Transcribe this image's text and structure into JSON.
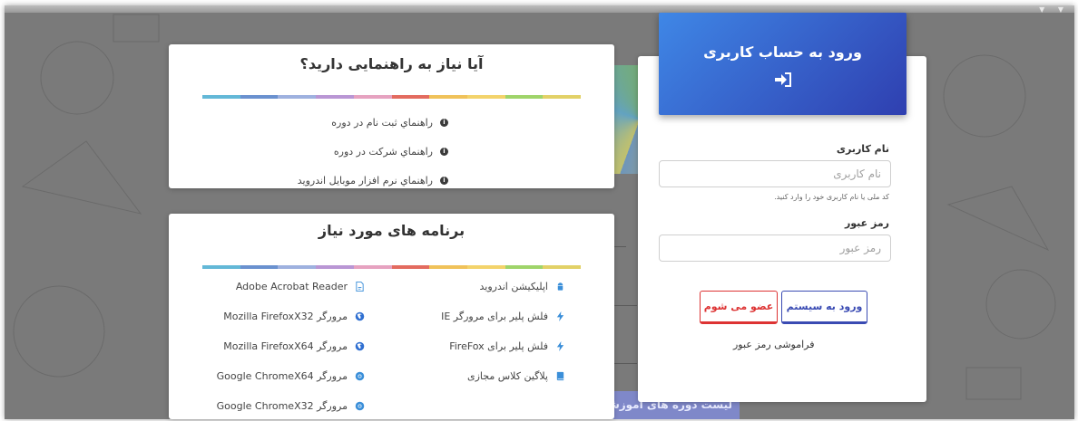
{
  "colors": {
    "rainbow": [
      "#e2d167",
      "#9fd46a",
      "#f3d36b",
      "#f0c25a",
      "#e36b5f",
      "#e6a2c0",
      "#b996d4",
      "#9eb1df",
      "#6a91cf",
      "#63b8d7"
    ],
    "login_header_start": "#3f87e6",
    "login_header_end": "#2f3fb0",
    "primary": "#3a4bb3",
    "danger": "#dd3333"
  },
  "help": {
    "title": "آیا نیاز به راهنمایی دارید؟",
    "links": [
      {
        "label": "راهنماي ثبت نام در دوره",
        "icon": "info-circle-icon"
      },
      {
        "label": "راهنماي شرکت در دوره",
        "icon": "info-circle-icon"
      },
      {
        "label": "راهنماي نرم افزار موبايل اندرويد",
        "icon": "info-circle-icon"
      }
    ]
  },
  "software": {
    "title": "برنامه های مورد نیاز",
    "right_column": [
      {
        "label": "اپلیکیشن اندروید",
        "icon": "android-icon"
      },
      {
        "label": "فلش پلیر برای مرورگر IE",
        "icon": "lightning-icon"
      },
      {
        "label": "فلش پلیر برای FireFox",
        "icon": "lightning-icon"
      },
      {
        "label": "پلاگین کلاس مجازی",
        "icon": "book-icon"
      }
    ],
    "left_column": [
      {
        "label": "Adobe Acrobat Reader",
        "icon": "pdf-file-icon"
      },
      {
        "label": "مرورگر Mozilla FirefoxX32",
        "icon": "firefox-icon"
      },
      {
        "label": "مرورگر Mozilla FirefoxX64",
        "icon": "firefox-icon"
      },
      {
        "label": "مرورگر Google ChromeX64",
        "icon": "chrome-icon"
      },
      {
        "label": "مرورگر Google ChromeX32",
        "icon": "chrome-icon"
      }
    ]
  },
  "login": {
    "title": "ورود به حساب کاربری",
    "username_label": "نام کاربری",
    "username_placeholder": "نام کاربری",
    "username_hint": "کد ملی یا نام کاربری خود را وارد کنید.",
    "password_label": "رمز عبور",
    "password_placeholder": "رمز عبور",
    "login_button": "ورود به سیستم",
    "join_button": "عضو می شوم",
    "forgot_password": "فراموشی رمز عبور"
  },
  "background": {
    "courses_button": "لیست دوره های آموزشی"
  }
}
